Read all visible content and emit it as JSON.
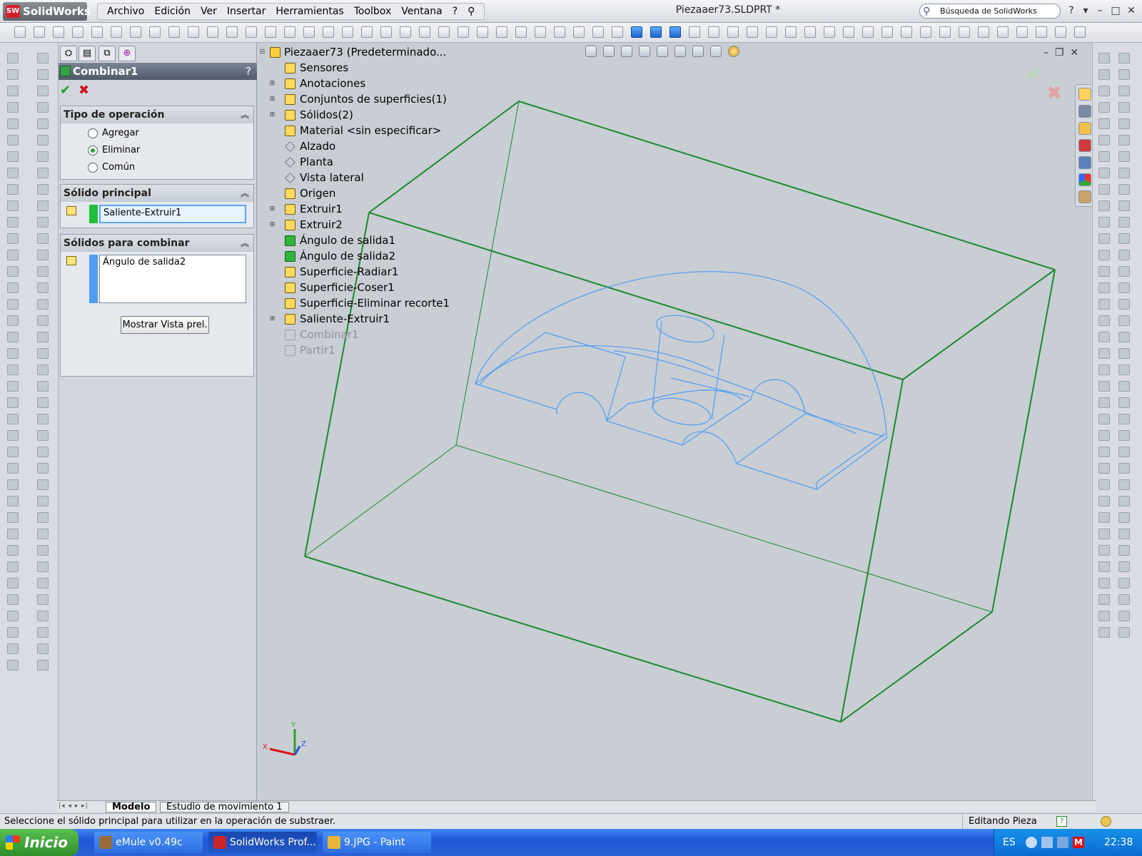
{
  "app": {
    "logo": "SolidWorks",
    "logo_badge": "SW"
  },
  "menu": [
    "Archivo",
    "Edición",
    "Ver",
    "Insertar",
    "Herramientas",
    "Toolbox",
    "Ventana",
    "?"
  ],
  "document_title": "Piezaaer73.SLDPRT *",
  "search_placeholder": "Búsqueda de SolidWorks",
  "property_manager": {
    "title": "Combinar1",
    "help": "?",
    "operation_section": {
      "title": "Tipo de operación",
      "options": [
        {
          "label": "Agregar",
          "selected": false
        },
        {
          "label": "Eliminar",
          "selected": true
        },
        {
          "label": "Común",
          "selected": false
        }
      ]
    },
    "main_body_section": {
      "title": "Sólido principal",
      "value": "Saliente-Extruir1",
      "color": "#1fbf3a"
    },
    "combine_section": {
      "title": "Sólidos para combinar",
      "value": "Ángulo de salida2",
      "color": "#4f9cf0"
    },
    "preview_button": "Mostrar Vista prel."
  },
  "feature_tree": {
    "root": "Piezaaer73  (Predeterminado...",
    "items": [
      {
        "label": "Sensores",
        "expandable": false,
        "dim": false
      },
      {
        "label": "Anotaciones",
        "expandable": true,
        "dim": false
      },
      {
        "label": "Conjuntos de superficies(1)",
        "expandable": true,
        "dim": false
      },
      {
        "label": "Sólidos(2)",
        "expandable": true,
        "dim": false
      },
      {
        "label": "Material <sin especificar>",
        "expandable": false,
        "dim": false
      },
      {
        "label": "Alzado",
        "expandable": false,
        "dim": false
      },
      {
        "label": "Planta",
        "expandable": false,
        "dim": false
      },
      {
        "label": "Vista lateral",
        "expandable": false,
        "dim": false
      },
      {
        "label": "Origen",
        "expandable": false,
        "dim": false
      },
      {
        "label": "Extruir1",
        "expandable": true,
        "dim": false
      },
      {
        "label": "Extruir2",
        "expandable": true,
        "dim": false
      },
      {
        "label": "Ángulo de salida1",
        "expandable": false,
        "dim": false
      },
      {
        "label": "Ángulo de salida2",
        "expandable": false,
        "dim": false
      },
      {
        "label": "Superficie-Radiar1",
        "expandable": false,
        "dim": false
      },
      {
        "label": "Superficie-Coser1",
        "expandable": false,
        "dim": false
      },
      {
        "label": "Superficie-Eliminar recorte1",
        "expandable": false,
        "dim": false
      },
      {
        "label": "Saliente-Extruir1",
        "expandable": true,
        "dim": false
      },
      {
        "label": "Combinar1",
        "expandable": false,
        "dim": true
      },
      {
        "label": "Partir1",
        "expandable": false,
        "dim": true
      }
    ]
  },
  "axis_labels": {
    "x": "X",
    "y": "Y",
    "z": "Z"
  },
  "bottom_tabs": [
    "Modelo",
    "Estudio de movimiento 1"
  ],
  "status": {
    "message": "Seleccione el sólido principal para utilizar en la operación de substraer.",
    "mode": "Editando Pieza",
    "help": "?"
  },
  "taskbar": {
    "start": "Inicio",
    "tasks": [
      {
        "label": "eMule v0.49c",
        "active": false
      },
      {
        "label": "SolidWorks Prof...",
        "active": true
      },
      {
        "label": "9.JPG - Paint",
        "active": false
      }
    ],
    "lang": "ES",
    "clock": "22:38"
  },
  "colors": {
    "box_edge": "#1b8a2e",
    "part_edge": "#4f9ef5"
  }
}
